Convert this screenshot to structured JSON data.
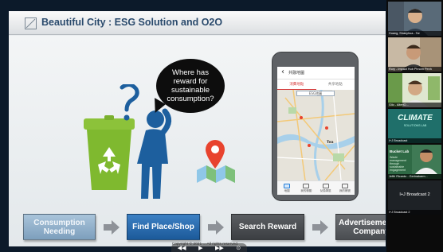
{
  "slide": {
    "title": "Beautiful City : ESG Solution and O2O",
    "bubble_text": "Where has\nreward for\nsustainable\nconsumption?",
    "footer": "Copyright © 2021 ... All rights reserved."
  },
  "phone": {
    "title": "共融地圖",
    "tabs": [
      "消費地點",
      "共享地點"
    ],
    "search": "ESG地圖",
    "map_label": "Tea",
    "nav": [
      "地圖",
      "我的獎勵",
      "兌換專區",
      "我的帳號"
    ]
  },
  "flow": {
    "steps": [
      "Consumption\nNeeding",
      "Find Place/Shop",
      "Search Reward",
      "Advertisement of\nCompany"
    ]
  },
  "presenter_controls": [
    "◀◀",
    "▶",
    "▶▶",
    "⊙"
  ],
  "participants": [
    {
      "name": "Huang, Shaoyhua...Tai"
    },
    {
      "name": "Rory - Impact Hub Phnom Penh"
    },
    {
      "name": "Gilo - AlteriO..."
    },
    {
      "name": "I+J Broadcast",
      "card_title": "CLIMATE",
      "card_subtitle": "SOLUTIONS LAB"
    },
    {
      "name": "Jeffri Ricardo - Gerinakarm...",
      "card_title": "Bucket Lab",
      "card_lines": "Waste management through sustainable engagement"
    },
    {
      "name": "I+J Broadcast 2",
      "center_text": "I+J Broadcast 2"
    }
  ],
  "colors": {
    "title_text": "#2a4a6c",
    "step_active": "#2569ab",
    "step_done": "#8fb0cc",
    "step_pending": "#4a4d51",
    "arrow": "#8e9298"
  }
}
